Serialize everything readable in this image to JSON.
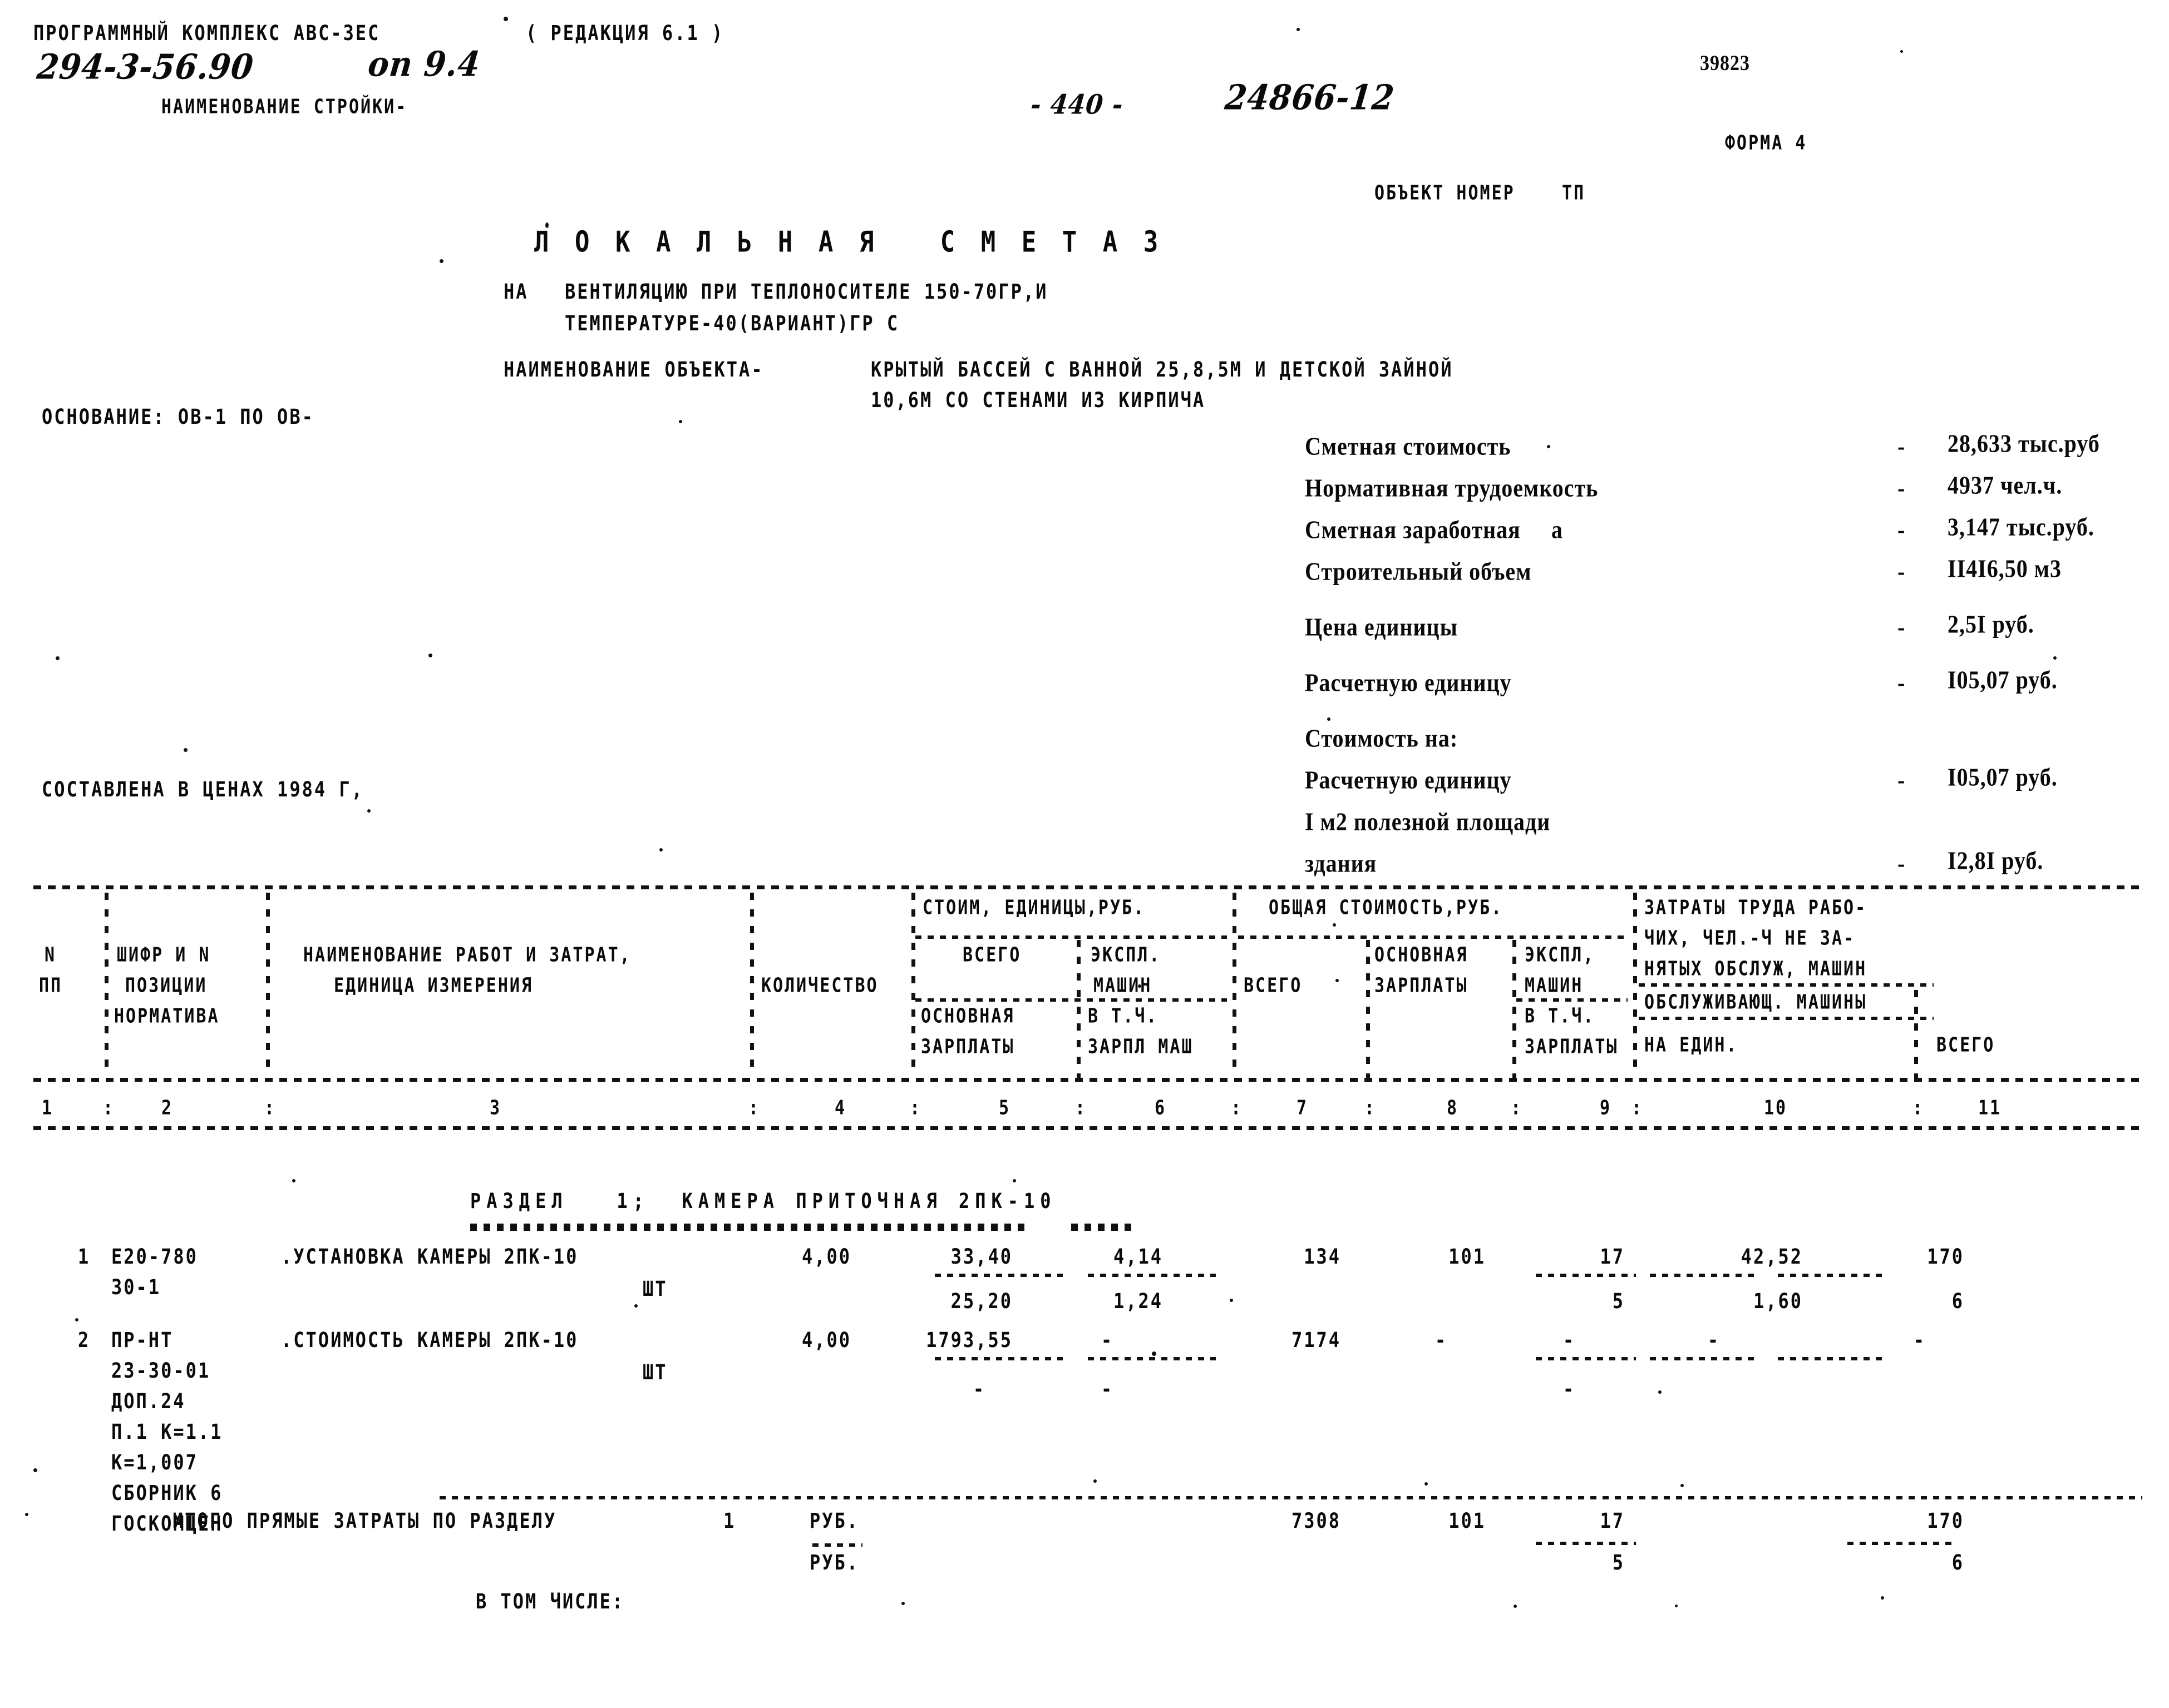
{
  "header": {
    "program_complex": "ПРОГРАММНЫЙ КОМПЛЕКС АВС-3ЕС",
    "edition": "( РЕДАКЦИЯ 6.1 )",
    "doc_code": "294-3-56.90",
    "sheet_mark": "оп 9.4",
    "building_name_label": "НАИМЕНОВАНИЕ СТРОЙКИ-",
    "page_number": "- 440 -",
    "handwritten_number": "24866-12",
    "archive_number": "39823",
    "form_label": "ФОРМА 4",
    "object_number": "ОБЪЕКТ НОМЕР    ТП"
  },
  "title": {
    "main": "Л О К А Л Ь Н А Я   С М Е Т А 3",
    "subject_prefix": "НА",
    "subject_line1": "ВЕНТИЛЯЦИЮ ПРИ ТЕПЛОНОСИТЕЛЕ 150-70ГР,И",
    "subject_line2": "ТЕМПЕРАТУРЕ-40(ВАРИАНТ)ГР С",
    "object_label": "НАИМЕНОВАНИЕ ОБЪЕКТА-",
    "object_line1": "КРЫТЫЙ БАССЕЙ С ВАННОЙ 25,8,5М И ДЕТСКОЙ ЗАЙНОЙ",
    "object_line2": "10,6М СО СТЕНАМИ ИЗ КИРПИЧА"
  },
  "left_notes": {
    "basis": "ОСНОВАНИЕ: ОВ-1 ПО ОВ-",
    "prices": "СОСТАВЛЕНА В ЦЕНАХ 1984 Г,"
  },
  "summary": {
    "dash": "-",
    "group_label": "Стоимость на:",
    "items": [
      {
        "label": "Сметная стоимость",
        "value": "28,633 тыс.руб"
      },
      {
        "label": "Нормативная трудоемкость",
        "value": "4937 чел.ч."
      },
      {
        "label": "Сметная заработная     а",
        "value": "3,147 тыс.руб."
      },
      {
        "label": "Строительный объем",
        "value": "II4I6,50 м3"
      },
      {
        "label": "Цена единицы",
        "value": "2,5I руб."
      },
      {
        "label": "Расчетную единицу",
        "value": "I05,07 руб."
      }
    ],
    "items2": [
      {
        "label": "Расчетную единицу",
        "value": "I05,07 руб."
      },
      {
        "label": "I м2 полезной площади",
        "value": ""
      },
      {
        "label": "здания",
        "value": "I2,8I руб."
      }
    ]
  },
  "table": {
    "headers": {
      "col_n": "N",
      "col_pp": "ПП",
      "cipher_l1": "ШИФР И N",
      "cipher_l2": "ПОЗИЦИИ",
      "cipher_l3": "НОРМАТИВА",
      "name_l1": "НАИМЕНОВАНИЕ РАБОТ И ЗАТРАТ,",
      "name_l2": "ЕДИНИЦА ИЗМЕРЕНИЯ",
      "qty": "КОЛИЧЕСТВО",
      "unit_cost": "СТОИМ, ЕДИНИЦЫ,РУБ.",
      "unit_total": "ВСЕГО",
      "unit_mach_l1": "ЭКСПЛ.",
      "unit_mach_l2": "МАШИН",
      "unit_base_l1": "ОСНОВНАЯ",
      "unit_base_l2": "ЗАРПЛАТЫ",
      "unit_incl_l1": "В Т.Ч.",
      "unit_incl_l2": "ЗАРПЛ МАШ",
      "total_cost": "ОБЩАЯ СТОИМОСТЬ,РУБ.",
      "total_all": "ВСЕГО",
      "total_base_l1": "ОСНОВНАЯ",
      "total_base_l2": "ЗАРПЛАТЫ",
      "total_mach_l1": "ЭКСПЛ,",
      "total_mach_l2": "МАШИН",
      "total_incl_l1": "В Т.Ч.",
      "total_incl_l2": "ЗАРПЛАТЫ",
      "labor_l1": "ЗАТРАТЫ ТРУДА РАБО-",
      "labor_l2": "ЧИХ, ЧЕЛ.-Ч НЕ ЗА-",
      "labor_l3": "НЯТЫХ ОБСЛУЖ, МАШИН",
      "labor_l4": "ОБСЛУЖИВАЮЩ. МАШИНЫ",
      "labor_unit": "НА ЕДИН.",
      "labor_total": "ВСЕГО"
    },
    "column_numbers": [
      "1",
      "2",
      "3",
      "4",
      "5",
      "6",
      "7",
      "8",
      "9",
      "10",
      "11"
    ],
    "section_title": "РАЗДЕЛ   1;  КАМЕРА ПРИТОЧНАЯ 2ПК-10",
    "rows": [
      {
        "n": "1",
        "cipher_l1": "Е20-780",
        "cipher_l2": "30-1",
        "name": ".УСТАНОВКА КАМЕРЫ 2ПК-10",
        "unit": "ШТ",
        "qty": "4,00",
        "unit_total": "33,40",
        "unit_mach": "4,14",
        "unit_base": "25,20",
        "unit_incl": "1,24",
        "total_all": "134",
        "total_base": "101",
        "total_mach": "17",
        "total_incl": "5",
        "labor_unit": "42,52",
        "labor_unit2": "1,60",
        "labor_total": "170",
        "labor_total2": "6"
      },
      {
        "n": "2",
        "cipher_l1": "ПР-НТ",
        "cipher_l2": "23-30-01",
        "cipher_l3": "ДОП.24",
        "cipher_l4": "П.1 К=1.1",
        "cipher_l5": "К=1,007",
        "cipher_l6": "СБОРНИК 6",
        "cipher_l7": "ГОСКОМЦЕН",
        "name": ".СТОИМОСТЬ КАМЕРЫ 2ПК-10",
        "unit": "ШТ",
        "qty": "4,00",
        "unit_total": "1793,55",
        "unit_mach": "-",
        "unit_base": "-",
        "unit_incl": "-",
        "total_all": "7174",
        "total_base": "-",
        "total_mach": "-",
        "total_incl": "-",
        "labor_unit": "-",
        "labor_total": "-"
      }
    ],
    "totals": {
      "label": "ИТОГО ПРЯМЫЕ ЗАТРАТЫ ПО РАЗДЕЛУ",
      "section_no": "1",
      "unit1": "РУБ.",
      "unit2": "РУБ.",
      "including": "В ТОМ ЧИСЛЕ:",
      "total_all": "7308",
      "total_base": "101",
      "total_mach": "17",
      "total_incl": "5",
      "labor_total": "170",
      "labor_total2": "6"
    }
  }
}
